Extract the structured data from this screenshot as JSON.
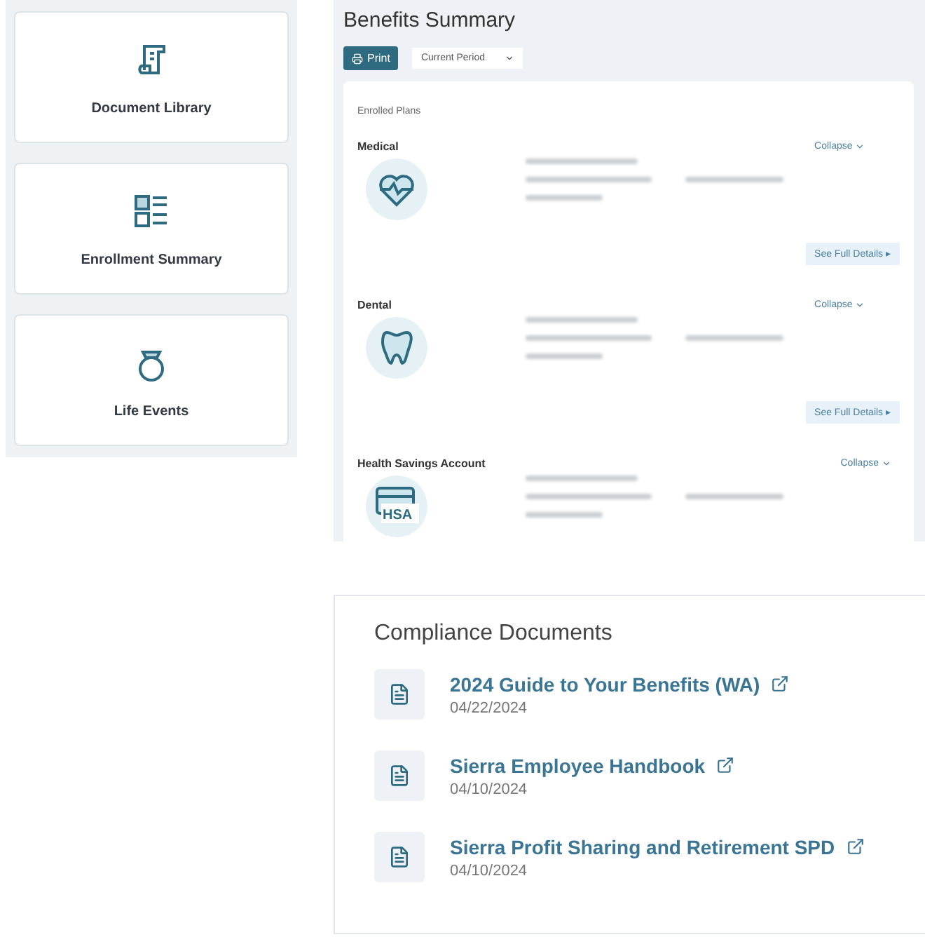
{
  "tiles": [
    {
      "label": "Document Library"
    },
    {
      "label": "Enrollment Summary"
    },
    {
      "label": "Life Events"
    }
  ],
  "benefits": {
    "title": "Benefits Summary",
    "print_label": "Print",
    "period": "Current Period",
    "section_label": "Enrolled Plans",
    "plans": [
      {
        "name": "Medical",
        "toggle": "Collapse",
        "details": "See Full Details ▸"
      },
      {
        "name": "Dental",
        "toggle": "Collapse",
        "details": "See Full Details ▸"
      },
      {
        "name": "Health Savings Account",
        "icon_text": "HSA",
        "toggle": "Collapse"
      }
    ]
  },
  "compliance": {
    "title": "Compliance Documents",
    "documents": [
      {
        "title": "2024 Guide to Your Benefits (WA)",
        "date": "04/22/2024"
      },
      {
        "title": "Sierra Employee Handbook",
        "date": "04/10/2024"
      },
      {
        "title": "Sierra Profit Sharing and Retirement SPD",
        "date": "04/10/2024"
      }
    ]
  }
}
